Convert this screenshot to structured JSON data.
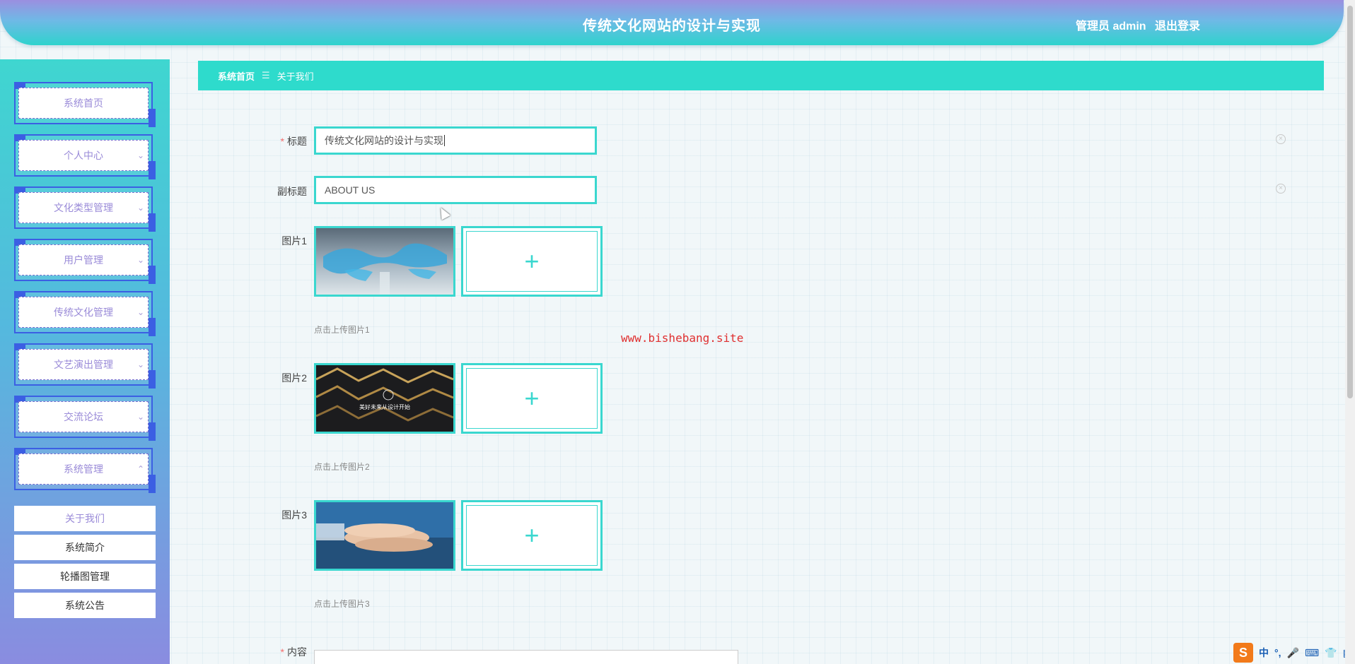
{
  "header": {
    "title": "传统文化网站的设计与实现",
    "user": "管理员 admin",
    "logout": "退出登录"
  },
  "sidebar": {
    "items": [
      {
        "label": "系统首页",
        "has_chevron": false
      },
      {
        "label": "个人中心",
        "has_chevron": true
      },
      {
        "label": "文化类型管理",
        "has_chevron": true
      },
      {
        "label": "用户管理",
        "has_chevron": true
      },
      {
        "label": "传统文化管理",
        "has_chevron": true
      },
      {
        "label": "文艺演出管理",
        "has_chevron": true
      },
      {
        "label": "交流论坛",
        "has_chevron": true
      },
      {
        "label": "系统管理",
        "has_chevron": true,
        "expanded": true
      }
    ],
    "sub_items": [
      {
        "label": "关于我们",
        "active": true
      },
      {
        "label": "系统简介"
      },
      {
        "label": "轮播图管理"
      },
      {
        "label": "系统公告"
      }
    ],
    "chevron_down": "⌄",
    "chevron_up": "⌃"
  },
  "breadcrumb": {
    "home": "系统首页",
    "separator": "☰",
    "current": "关于我们"
  },
  "form": {
    "title": {
      "label": "标题",
      "required": "*",
      "value": "传统文化网站的设计与实现"
    },
    "subtitle": {
      "label": "副标题",
      "value": "ABOUT US"
    },
    "images": [
      {
        "label": "图片1",
        "hint": "点击上传图片1"
      },
      {
        "label": "图片2",
        "hint": "点击上传图片2",
        "thumb_caption": "美好未来从设计开始"
      },
      {
        "label": "图片3",
        "hint": "点击上传图片3"
      }
    ],
    "content": {
      "label": "内容",
      "required": "*"
    },
    "upload_icon": "+",
    "clear_icon": "×"
  },
  "watermark": "www.bishebang.site",
  "ime": {
    "logo": "S",
    "lang": "中",
    "punct": "°,"
  },
  "colors": {
    "accent": "#3ad7cf",
    "breadcrumb_bg": "#2edbcc",
    "nav_border": "#3b5fe3",
    "nav_text": "#9a8bd8",
    "required": "#f56c6c"
  }
}
